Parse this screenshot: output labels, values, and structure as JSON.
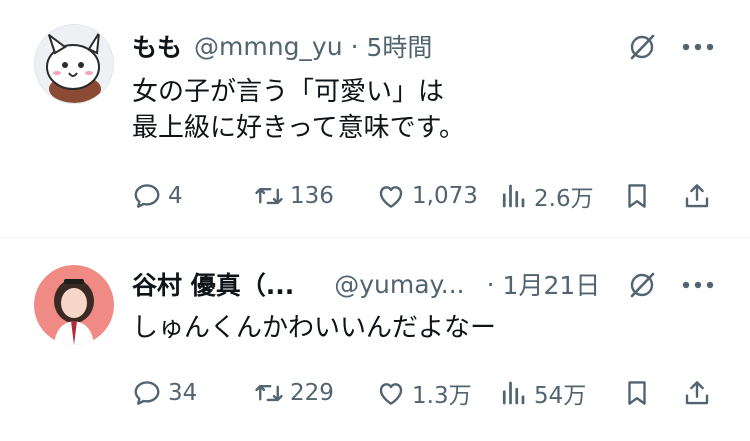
{
  "tweets": [
    {
      "name": "もも",
      "handle": "@mmng_yu",
      "separator": "·",
      "time": "5時間",
      "text_lines": [
        "女の子が言う「可愛い」は",
        "最上級に好きって意味です。"
      ],
      "replies": "4",
      "reposts": "136",
      "likes": "1,073",
      "views": "2.6万"
    },
    {
      "name": "谷村 優真（...",
      "handle": "@yumay...",
      "separator": "·",
      "time": "1月21日",
      "text_lines": [
        "しゅんくんかわいいんだよなー"
      ],
      "replies": "34",
      "reposts": "229",
      "likes": "1.3万",
      "views": "54万"
    }
  ],
  "icons": {
    "reply": "speech-bubble-icon",
    "repost": "repost-arrows-icon",
    "like": "heart-icon",
    "views": "bar-chart-icon",
    "bookmark": "bookmark-icon",
    "share": "share-upload-icon",
    "grok": "grok-slash-circle-icon",
    "more": "more-dots-icon"
  },
  "colors": {
    "text_primary": "#0f1419",
    "text_secondary": "#536471",
    "divider": "#eff3f4"
  }
}
